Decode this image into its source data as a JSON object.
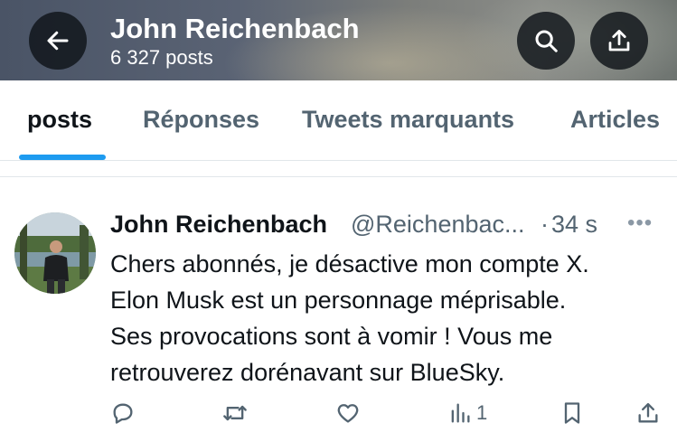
{
  "header": {
    "title": "John Reichenbach",
    "post_count": "6 327 posts"
  },
  "tabs": [
    {
      "label": "posts",
      "active": true
    },
    {
      "label": "Réponses",
      "active": false
    },
    {
      "label": "Tweets marquants",
      "active": false
    },
    {
      "label": "Articles",
      "active": false
    }
  ],
  "tweet": {
    "author_name": "John Reichenbach",
    "handle": "@Reichenbac...",
    "separator": "·",
    "time": "34 s",
    "more": "•••",
    "lines": [
      "Chers abonnés, je désactive mon compte X.",
      "Elon Musk est un personnage méprisable.",
      "Ses provocations sont à vomir ! Vous me",
      "retrouverez dorénavant sur BlueSky."
    ],
    "views_count": "1"
  },
  "icons": {
    "back": "arrow-left-icon",
    "search": "search-icon",
    "share_header": "share-icon",
    "reply": "reply-icon",
    "retweet": "retweet-icon",
    "like": "heart-icon",
    "views": "views-icon",
    "bookmark": "bookmark-icon",
    "share": "share-icon"
  },
  "colors": {
    "accent": "#1d9bf0",
    "text_primary": "#0f1419",
    "text_secondary": "#536471"
  }
}
